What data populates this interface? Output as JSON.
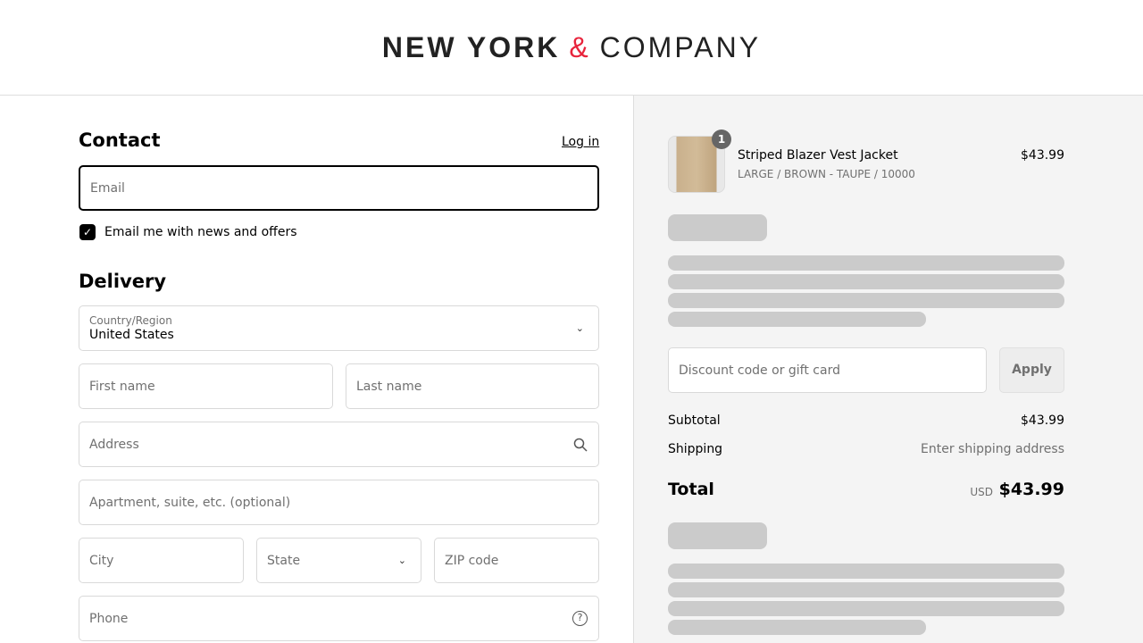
{
  "logo": {
    "bold": "NEW YORK",
    "amp": "&",
    "light": "COMPANY"
  },
  "contact": {
    "title": "Contact",
    "login": "Log in",
    "email_placeholder": "Email",
    "newsletter": "Email me with news and offers"
  },
  "delivery": {
    "title": "Delivery",
    "country_label": "Country/Region",
    "country_value": "United States",
    "first_name": "First name",
    "last_name": "Last name",
    "address": "Address",
    "apartment": "Apartment, suite, etc. (optional)",
    "city": "City",
    "state": "State",
    "zip": "ZIP code",
    "phone": "Phone"
  },
  "cart": {
    "item": {
      "name": "Striped Blazer Vest Jacket",
      "variant": "LARGE / BROWN - TAUPE / 10000",
      "price": "$43.99",
      "quantity": "1"
    },
    "discount_placeholder": "Discount code or gift card",
    "apply": "Apply",
    "subtotal_label": "Subtotal",
    "subtotal": "$43.99",
    "shipping_label": "Shipping",
    "shipping": "Enter shipping address",
    "total_label": "Total",
    "currency": "USD",
    "total": "$43.99"
  }
}
